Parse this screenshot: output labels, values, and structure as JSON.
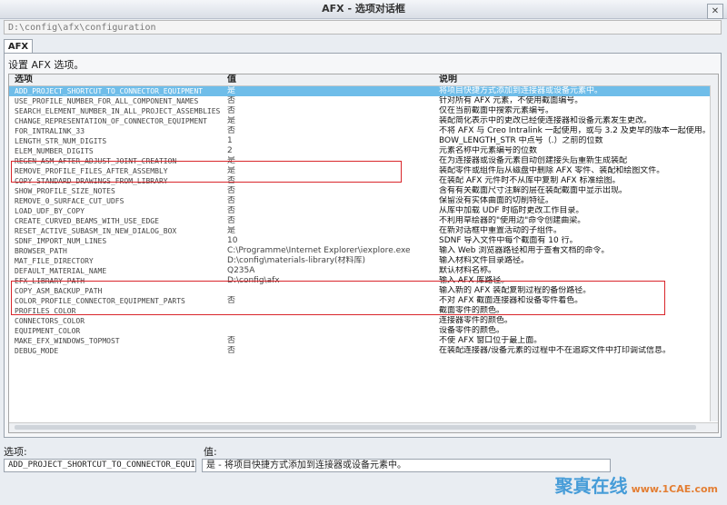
{
  "window": {
    "title": "AFX - 选项对话框",
    "path": "D:\\config\\afx\\configuration",
    "tab": "AFX",
    "description": "设置 AFX 选项。"
  },
  "table": {
    "headers": {
      "option": "选项",
      "value": "值",
      "description": "说明"
    },
    "rows": [
      {
        "option": "ADD_PROJECT_SHORTCUT_TO_CONNECTOR_EQUIPMENT",
        "value": "是",
        "description": "将项目快捷方式添加到连接器或设备元素中。"
      },
      {
        "option": "USE_PROFILE_NUMBER_FOR_ALL_COMPONENT_NAMES",
        "value": "否",
        "description": "针对所有 AFX 元素，不使用截面编号。"
      },
      {
        "option": "SEARCH_ELEMENT_NUMBER_IN_ALL_PROJECT_ASSEMBLIES",
        "value": "否",
        "description": "仅在当前截面中搜索元素编号。"
      },
      {
        "option": "CHANGE_REPRESENTATION_OF_CONNECTOR_EQUIPMENT",
        "value": "是",
        "description": "装配简化表示中的更改已经使连接器和设备元素发生更改。"
      },
      {
        "option": "FOR_INTRALINK_33",
        "value": "否",
        "description": "不将 AFX 与 Creo Intralink 一起使用，或与 3.2 及更早的版本一起使用。"
      },
      {
        "option": "LENGTH_STR_NUM_DIGITS",
        "value": "1",
        "description": "BOW_LENGTH_STR 中点号（.）之前的位数"
      },
      {
        "option": "ELEM_NUMBER_DIGITS",
        "value": "2",
        "description": "元素名称中元素编号的位数"
      },
      {
        "option": "REGEN_ASM_AFTER_ADJUST_JOINT_CREATION",
        "value": "是",
        "description": "在为连接器或设备元素自动创建接头后重新生成装配"
      },
      {
        "option": "REMOVE_PROFILE_FILES_AFTER_ASSEMBLY",
        "value": "是",
        "description": "装配零件或组件后从磁盘中删除 AFX 零件、装配和绘图文件。"
      },
      {
        "option": "COPY_STANDARD_DRAWINGS_FROM_LIBRARY",
        "value": "否",
        "description": "在装配 AFX 元件时不从库中复制 AFX 标准绘图。"
      },
      {
        "option": "SHOW_PROFILE_SIZE_NOTES",
        "value": "否",
        "description": "含有有关截面尺寸注解的层在装配截面中显示出现。"
      },
      {
        "option": "REMOVE_0_SURFACE_CUT_UDFS",
        "value": "否",
        "description": "保留没有实体曲面的切削特征。"
      },
      {
        "option": "LOAD_UDF_BY_COPY",
        "value": "否",
        "description": "从库中加载 UDF 时临时更改工作目录。"
      },
      {
        "option": "CREATE_CURVED_BEAMS_WITH_USE_EDGE",
        "value": "否",
        "description": "不利用草绘器的\"使用边\"命令创建曲梁。"
      },
      {
        "option": "RESET_ACTIVE_SUBASM_IN_NEW_DIALOG_BOX",
        "value": "是",
        "description": "在新对话框中重置活动的子组件。"
      },
      {
        "option": "SDNF_IMPORT_NUM_LINES",
        "value": "10",
        "description": "SDNF 导入文件中每个截面有 10 行。"
      },
      {
        "option": "BROWSER_PATH",
        "value": "C:\\Programme\\Internet Explorer\\iexplore.exe",
        "description": "输入 Web 浏览器路径和用于查看文档的命令。"
      },
      {
        "option": "MAT_FILE_DIRECTORY",
        "value": "D:\\config\\materials-library(材料库)",
        "description": "输入材料文件目录路径。"
      },
      {
        "option": "DEFAULT_MATERIAL_NAME",
        "value": "Q235A",
        "description": "默认材料名称。"
      },
      {
        "option": "EFX_LIBRARY_PATH",
        "value": "D:\\config\\afx",
        "description": "输入 AFX 库路径。"
      },
      {
        "option": "COPY_ASM_BACKUP_PATH",
        "value": "",
        "description": "输入新的 AFX 装配复制过程的备份路径。"
      },
      {
        "option": "COLOR_PROFILE_CONNECTOR_EQUIPMENT_PARTS",
        "value": "否",
        "description": "不对 AFX 截面连接器和设备零件着色。"
      },
      {
        "option": "PROFILES_COLOR",
        "value": "",
        "description": "截面零件的颜色。"
      },
      {
        "option": "CONNECTORS_COLOR",
        "value": "",
        "description": "连接器零件的颜色。"
      },
      {
        "option": "EQUIPMENT_COLOR",
        "value": "",
        "description": "设备零件的颜色。"
      },
      {
        "option": "MAKE_EFX_WINDOWS_TOPMOST",
        "value": "否",
        "description": "不使 AFX 窗口位于最上面。"
      },
      {
        "option": "DEBUG_MODE",
        "value": "否",
        "description": "在装配连接器/设备元素的过程中不在追踪文件中打印调试信息。"
      }
    ]
  },
  "bottom": {
    "option_label": "选项:",
    "value_label": "值:",
    "option_value": "ADD_PROJECT_SHORTCUT_TO_CONNECTOR_EQUIPMENT",
    "value_value": "是 - 将项目快捷方式添加到连接器或设备元素中。"
  },
  "watermark": {
    "main": "聚真在线",
    "sub": "www.1CAE.com"
  }
}
